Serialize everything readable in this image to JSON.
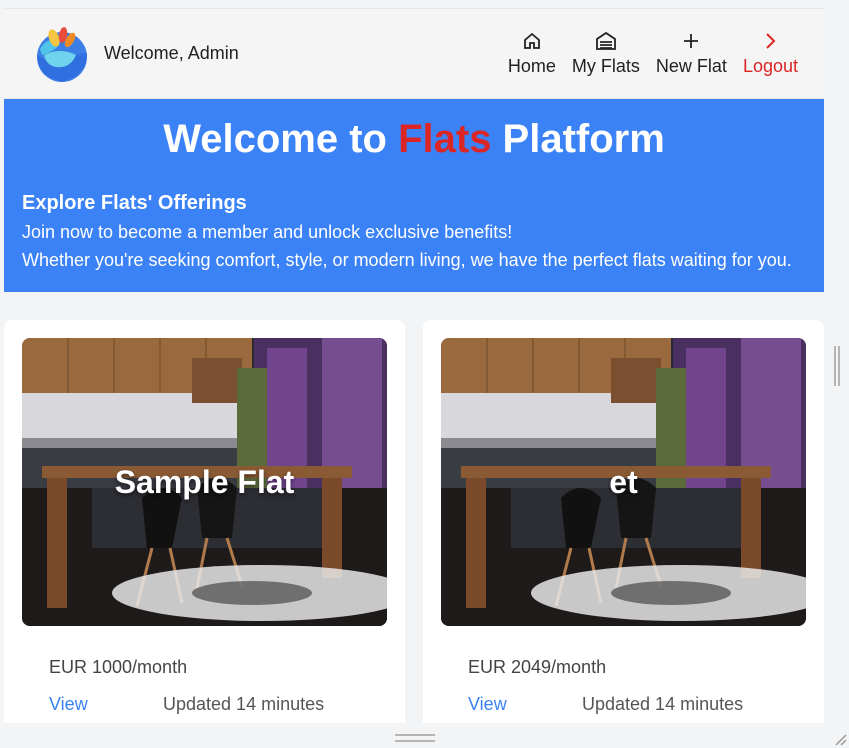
{
  "header": {
    "welcome": "Welcome, Admin",
    "nav": [
      {
        "label": "Home",
        "icon": "home-icon"
      },
      {
        "label": "My Flats",
        "icon": "garage-icon"
      },
      {
        "label": "New Flat",
        "icon": "plus-icon"
      },
      {
        "label": "Logout",
        "icon": "chevron-right-icon"
      }
    ]
  },
  "hero": {
    "title_pre": "Welcome to ",
    "title_accent": "Flats",
    "title_post": " Platform",
    "subtitle": "Explore Flats' Offerings",
    "line1": "Join now to become a member and unlock exclusive benefits!",
    "line2": "Whether you're seeking comfort, style, or modern living, we have the perfect flats waiting for you."
  },
  "cards": [
    {
      "title": "Sample Flat",
      "price": "EUR 1000/month",
      "view_label": "View",
      "updated": "Updated 14 minutes"
    },
    {
      "title": "et",
      "price": "EUR 2049/month",
      "view_label": "View",
      "updated": "Updated 14 minutes"
    }
  ],
  "colors": {
    "accent": "#3b82f6",
    "danger": "#dc2626"
  }
}
